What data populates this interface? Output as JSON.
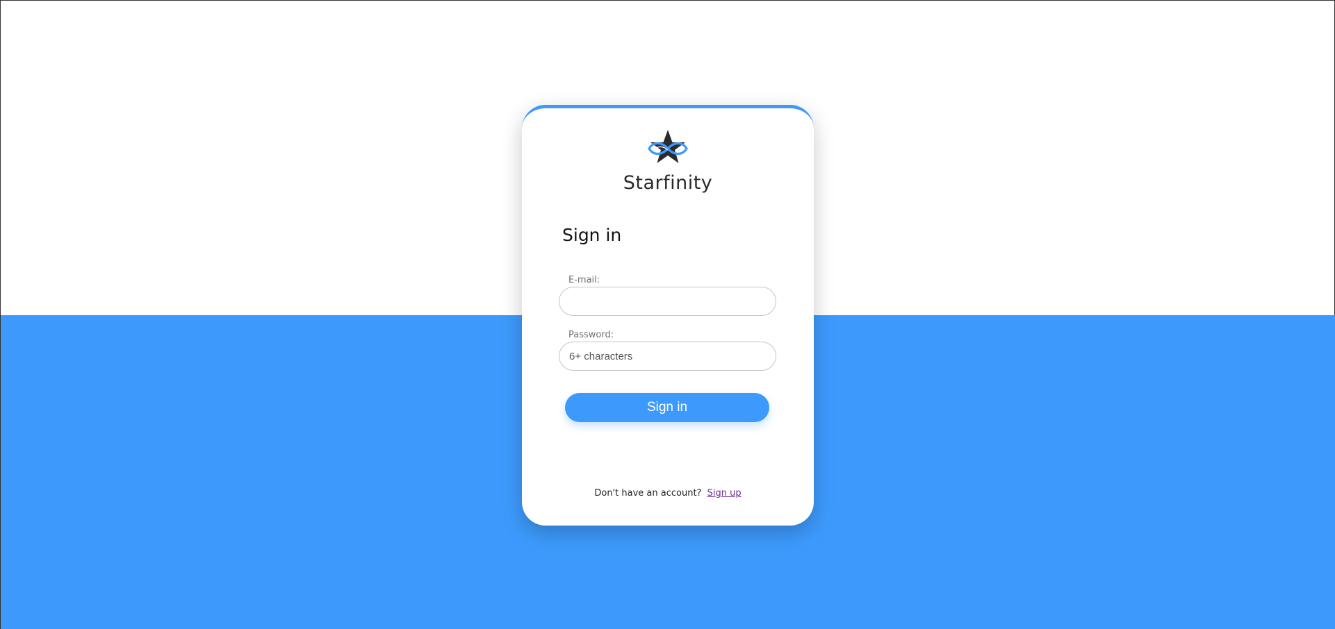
{
  "brand": {
    "name": "Starfinity",
    "logo_icon": "star-infinity-logo-icon"
  },
  "form": {
    "heading": "Sign in",
    "email": {
      "label": "E-mail:",
      "value": "",
      "placeholder": ""
    },
    "password": {
      "label": "Password:",
      "value": "",
      "placeholder": "6+ characters"
    },
    "submit_label": "Sign in"
  },
  "footer": {
    "prompt": "Don't have an account?",
    "signup_link": "Sign up"
  },
  "colors": {
    "accent": "#3d9afc",
    "background_top": "#ffffff",
    "link": "#6a2c8f"
  }
}
